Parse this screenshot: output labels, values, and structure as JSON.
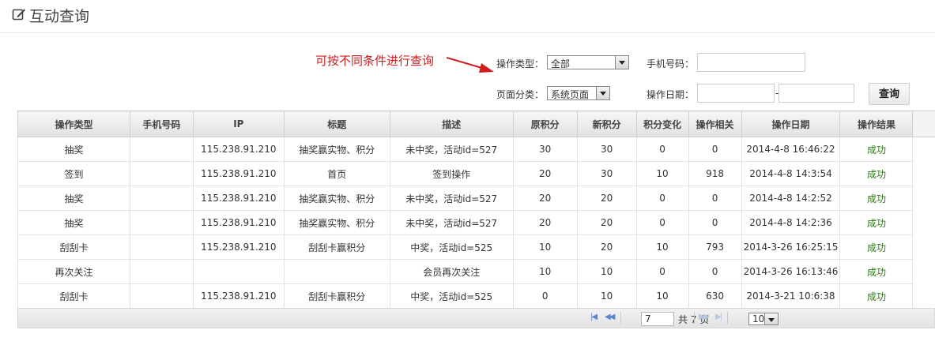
{
  "header": {
    "title": "互动查询",
    "icon": "edit-icon"
  },
  "annotation": "可按不同条件进行查询",
  "filters": {
    "op_type_label": "操作类型：",
    "op_type_value": "全部",
    "phone_label": "手机号码：",
    "phone_value": "",
    "page_cat_label": "页面分类：",
    "page_cat_value": "系统页面",
    "date_label": "操作日期：",
    "date_sep": "-",
    "query_button": "查询"
  },
  "table": {
    "columns": [
      "操作类型",
      "手机号码",
      "IP",
      "标题",
      "描述",
      "原积分",
      "新积分",
      "积分变化",
      "操作相关",
      "操作日期",
      "操作结果"
    ],
    "rows": [
      [
        "抽奖",
        "",
        "115.238.91.210",
        "抽奖赢实物、积分",
        "未中奖，活动id=527",
        "30",
        "30",
        "0",
        "0",
        "2014-4-8 16:46:22",
        "成功"
      ],
      [
        "签到",
        "",
        "115.238.91.210",
        "首页",
        "签到操作",
        "20",
        "30",
        "10",
        "918",
        "2014-4-8 14:3:54",
        "成功"
      ],
      [
        "抽奖",
        "",
        "115.238.91.210",
        "抽奖赢实物、积分",
        "未中奖，活动id=527",
        "20",
        "20",
        "0",
        "0",
        "2014-4-8 14:2:52",
        "成功"
      ],
      [
        "抽奖",
        "",
        "115.238.91.210",
        "抽奖赢实物、积分",
        "未中奖，活动id=527",
        "20",
        "20",
        "0",
        "0",
        "2014-4-8 14:2:36",
        "成功"
      ],
      [
        "刮刮卡",
        "",
        "115.238.91.210",
        "刮刮卡赢积分",
        "中奖，活动id=525",
        "10",
        "20",
        "10",
        "793",
        "2014-3-26 16:25:15",
        "成功"
      ],
      [
        "再次关注",
        "",
        "",
        "",
        "会员再次关注",
        "10",
        "10",
        "0",
        "0",
        "2014-3-26 16:13:46",
        "成功"
      ],
      [
        "刮刮卡",
        "",
        "115.238.91.210",
        "刮刮卡赢积分",
        "中奖，活动id=525",
        "0",
        "10",
        "10",
        "630",
        "2014-3-21 10:6:38",
        "成功"
      ]
    ]
  },
  "pager": {
    "page_input": "7",
    "total_text": "共 7 页",
    "page_size": "10"
  }
}
